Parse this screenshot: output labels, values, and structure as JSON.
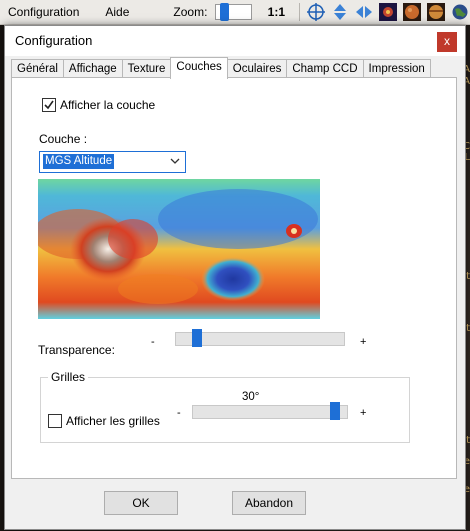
{
  "menubar": {
    "items": [
      "Configuration",
      "Aide"
    ],
    "zoom_label": "Zoom:",
    "zoom_value": "1:1",
    "zoom_level": 0.05,
    "icons": [
      "crosshair-icon",
      "arrows-vertical-icon",
      "arrows-horizontal-icon",
      "deep-sky-icon",
      "mars-icon",
      "jupiter-icon",
      "globe-icon"
    ]
  },
  "background": {
    "snippets": [
      "A",
      "A",
      "C",
      "L",
      "at",
      "at",
      "at",
      "ae",
      "e"
    ]
  },
  "dialog": {
    "title": "Configuration",
    "close_label": "x",
    "tabs": [
      "Général",
      "Affichage",
      "Texture",
      "Couches",
      "Oculaires",
      "Champ CCD",
      "Impression"
    ],
    "active_tab": "Couches",
    "couches": {
      "show_layer_label": "Afficher la couche",
      "show_layer_checked": true,
      "layer_label": "Couche :",
      "layer_selected": "MGS Altitude",
      "transparency_label": "Transparence:",
      "transparency_minus": "-",
      "transparency_plus": "+",
      "transparency_value": 0.1,
      "grids_title": "Grilles",
      "grids_value": "30°",
      "grids_slider_value": 0.95,
      "grids_minus": "-",
      "grids_plus": "+",
      "show_grids_label": "Afficher les grilles",
      "show_grids_checked": false
    },
    "buttons": {
      "ok": "OK",
      "cancel": "Abandon"
    }
  },
  "colors": {
    "accent": "#1e6fd6",
    "close": "#c0392b",
    "map_high": "#c0392b",
    "map_low": "#2d4fa8"
  }
}
